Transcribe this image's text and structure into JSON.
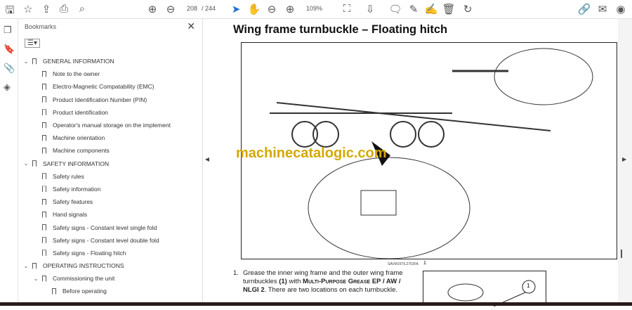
{
  "toolbar": {
    "page_current": "208",
    "page_total": "/ 244",
    "zoom": "109%",
    "icons": [
      "save-icon",
      "star-icon",
      "upload-icon",
      "print-icon",
      "search-icon",
      "page-up-icon",
      "page-down-icon",
      "select-icon",
      "hand-icon",
      "zoom-out-icon",
      "zoom-in-icon",
      "fit-icon",
      "scroll-mode-icon",
      "comment-icon",
      "pen-icon",
      "sign-icon",
      "delete-icon",
      "rotate-icon",
      "share-link-icon",
      "email-icon",
      "account-icon"
    ]
  },
  "panel": {
    "title": "Bookmarks",
    "close": "✕",
    "options": "☰▾"
  },
  "bookmarks": [
    {
      "label": "GENERAL INFORMATION",
      "level": 0,
      "expanded": true
    },
    {
      "label": "Note to the owner",
      "level": 1
    },
    {
      "label": "Electro-Magnetic Compatability (EMC)",
      "level": 1
    },
    {
      "label": "Product Identification Number (PIN)",
      "level": 1
    },
    {
      "label": "Product identification",
      "level": 1
    },
    {
      "label": "Operator's manual storage on the implement",
      "level": 1
    },
    {
      "label": "Machine orientation",
      "level": 1
    },
    {
      "label": "Machine components",
      "level": 1
    },
    {
      "label": "SAFETY INFORMATION",
      "level": 0,
      "expanded": true
    },
    {
      "label": "Safety rules",
      "level": 1
    },
    {
      "label": "Safety information",
      "level": 1
    },
    {
      "label": "Safety features",
      "level": 1
    },
    {
      "label": "Hand signals",
      "level": 1
    },
    {
      "label": "Safety signs - Constant level single fold",
      "level": 1
    },
    {
      "label": "Safety signs - Constant level double fold",
      "level": 1
    },
    {
      "label": "Safety signs - Floating hitch",
      "level": 1
    },
    {
      "label": "OPERATING INSTRUCTIONS",
      "level": 0,
      "expanded": true
    },
    {
      "label": "Commissioning the unit",
      "level": 1,
      "expanded": true
    },
    {
      "label": "Before operating",
      "level": 2
    }
  ],
  "document": {
    "title": "Wing frame turnbuckle – Floating hitch",
    "watermark": "machinecatalogic.com",
    "caption": "SAVM15TIL2753FA",
    "caption_num": "1",
    "callout": "1",
    "step_num": "1.",
    "step_a": "Grease the inner wing frame and the outer wing frame turnbuckles ",
    "step_b": "(1)",
    "step_c": " with ",
    "step_d": "Multi-Purpose Grease EP / AW / NLGI 2",
    "step_e": ". There are two locations on each turnbuckle."
  }
}
